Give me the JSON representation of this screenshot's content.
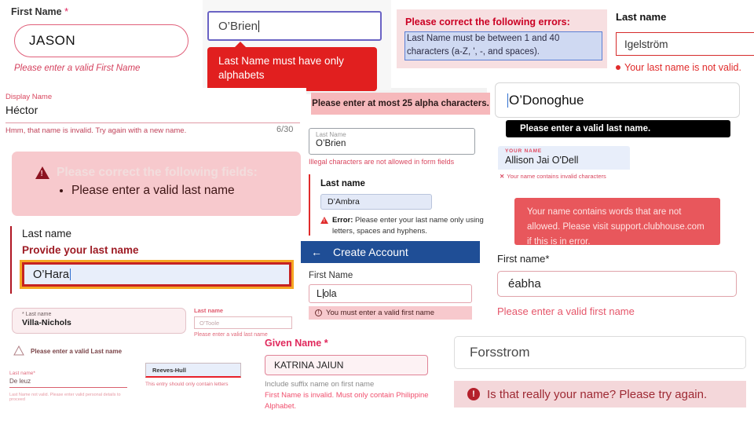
{
  "panel_first_name_jason": {
    "label": "First Name",
    "required_mark": "*",
    "value": "JASON",
    "error": "Please enter a valid First Name"
  },
  "panel_obrien_tooltip": {
    "value": "O’Brien",
    "tooltip": "Last Name must have only alphabets"
  },
  "panel_correct_errors": {
    "heading": "Please correct the following errors:",
    "detail": "Last Name must be between 1 and 40 characters (a-Z, ', -, and spaces)."
  },
  "panel_igelstrom": {
    "label": "Last name",
    "value": "Igelström",
    "error": "Your last name is not valid."
  },
  "panel_display_name": {
    "label": "Display Name",
    "value": "Héctor",
    "error": "Hmm, that name is invalid. Try again with a new name.",
    "counter": "6/30"
  },
  "panel_correct_fields": {
    "heading": "Please correct the following fields:",
    "items": [
      "Please enter a valid last name"
    ]
  },
  "panel_alpha25": {
    "message": "Please enter at most 25 alpha characters."
  },
  "panel_illegal_chars": {
    "placeholder": "Last Name",
    "value": "O’Brien",
    "error": "Illegal characters are not allowed in form fields"
  },
  "panel_dambra": {
    "label": "Last name",
    "value": "D’Ambra",
    "error_prefix": "Error:",
    "error": " Please enter your last name only using letters, spaces and hyphens."
  },
  "panel_create_account": {
    "back_icon": "←",
    "title": "Create Account",
    "label": "First Name",
    "value_before_caret": "L",
    "value_after_caret": "ola",
    "error": "You must enter a valid first name"
  },
  "panel_odonoghue": {
    "value": "O’Donoghue",
    "tooltip": "Please enter a valid last name."
  },
  "panel_your_name": {
    "label": "YOUR NAME",
    "value": "Allison Jai O'Dell",
    "error_icon": "✕",
    "error": "Your name contains invalid characters"
  },
  "panel_clubhouse": {
    "message": "Your name contains words that are not allowed. Please visit support.clubhouse.com if this is in error."
  },
  "panel_eabha": {
    "label": "First name*",
    "value": "éabha",
    "error": "Please enter a valid first name"
  },
  "panel_ohara": {
    "label": "Last name",
    "error_heading": "Provide your last name",
    "value": "O’Hara"
  },
  "panel_villa_nichols": {
    "label": "* Last name",
    "value": "Villa-Nichols"
  },
  "panel_otoole": {
    "label": "Last name",
    "value": "O'Toole",
    "error": "Please enter a valid last name"
  },
  "panel_warning_row": {
    "message": "Please enter a valid Last name"
  },
  "panel_de_leuz": {
    "label": "Last name*",
    "value": "De leuz",
    "error": "Last Name not valid. Please enter valid personal details to proceed"
  },
  "panel_reeves_hull": {
    "value": "Reeves-Hull",
    "error": "This entry should only contain letters"
  },
  "panel_given_name": {
    "label": "Given Name *",
    "value": "KATRINA JAIUN",
    "hint": "Include suffix name on first name",
    "error": "First Name is invalid. Must only contain Philippine Alphabet."
  },
  "panel_forsstrom": {
    "value": "Forsstrom"
  },
  "panel_really_your_name": {
    "icon": "!",
    "message": "Is that really your name? Please try again."
  }
}
